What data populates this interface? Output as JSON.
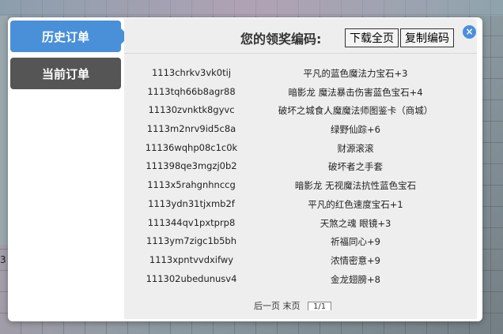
{
  "tabs": [
    {
      "label": "历史订单"
    },
    {
      "label": "当前订单"
    }
  ],
  "header": {
    "title": "您的领奖编码:",
    "download_label": "下载全页",
    "copy_label": "复制编码",
    "close_icon": "×"
  },
  "rows": [
    {
      "code": "1113chrkv3vk0tij",
      "prize": "平凡的蓝色魔法力宝石+3"
    },
    {
      "code": "1113tqh66b8agr88",
      "prize": "暗影龙 魔法暴击伤害蓝色宝石+4"
    },
    {
      "code": "11130zvnktk8gyvc",
      "prize": "破坏之城食人魔魔法师图鉴卡（商城）"
    },
    {
      "code": "1113m2nrv9id5c8a",
      "prize": "绿野仙踪+6"
    },
    {
      "code": "11136wqhp08c1c0k",
      "prize": "财源滚滚"
    },
    {
      "code": "111398qe3mgzj0b2",
      "prize": "破坏者之手套"
    },
    {
      "code": "1113x5rahgnhnccg",
      "prize": "暗影龙 无视魔法抗性蓝色宝石"
    },
    {
      "code": "1113ydn31tjxmb2f",
      "prize": "平凡的红色速度宝石+1"
    },
    {
      "code": "111344qv1pxtprp8",
      "prize": "天煞之魂 眼镜+3"
    },
    {
      "code": "1113ym7zigc1b5bh",
      "prize": "祈福同心+9"
    },
    {
      "code": "1113xpntvvdxifwy",
      "prize": "浓情密意+9"
    },
    {
      "code": "111302ubedunusv4",
      "prize": "金龙翅膀+8"
    }
  ],
  "pager": {
    "prev_label": "后一页",
    "first_label": "末页",
    "page_value": "1/1"
  },
  "background": {
    "side_text": "3"
  }
}
